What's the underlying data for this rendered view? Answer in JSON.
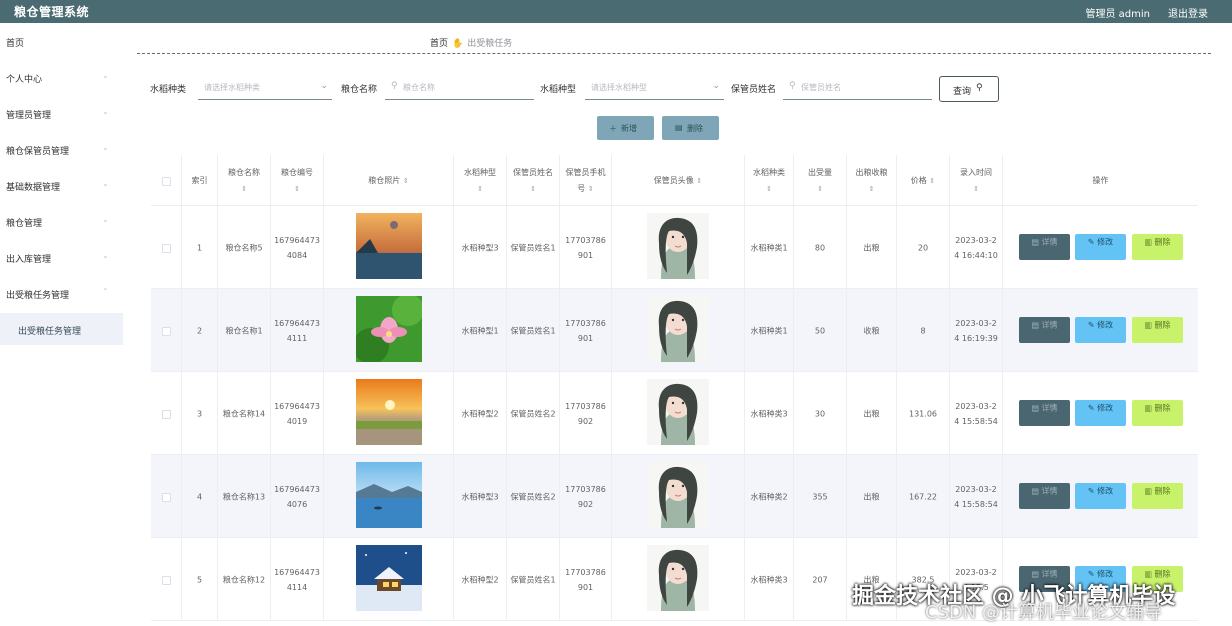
{
  "header": {
    "title": "粮仓管理系统",
    "admin_label": "管理员 admin",
    "logout_label": "退出登录"
  },
  "sidebar": {
    "items": [
      {
        "label": "首页"
      },
      {
        "label": "个人中心"
      },
      {
        "label": "管理员管理"
      },
      {
        "label": "粮仓保管员管理"
      },
      {
        "label": "基础数据管理"
      },
      {
        "label": "粮仓管理"
      },
      {
        "label": "出入库管理"
      },
      {
        "label": "出受粮任务管理"
      }
    ],
    "subitems": [
      {
        "label": "出受粮任务管理"
      }
    ]
  },
  "breadcrumb": {
    "home": "首页",
    "current": "出受粮任务"
  },
  "filters": {
    "rice_type_label": "水稻种类",
    "rice_type_placeholder": "请选择水稻种类",
    "granary_name_label": "粮仓名称",
    "granary_name_placeholder": "粮仓名称",
    "rice_kind_label": "水稻种型",
    "rice_kind_placeholder": "请选择水稻种型",
    "keeper_name_label": "保管员姓名",
    "keeper_name_placeholder": "保管员姓名",
    "query_label": "查询"
  },
  "actions": {
    "add_label": "新增",
    "delete_label": "删除"
  },
  "table": {
    "columns": {
      "index": "索引",
      "name": "粮仓名称",
      "code": "粮仓编号",
      "photo": "粮仓照片",
      "kind": "水稻种型",
      "keeper": "保管员姓名",
      "phone": "保管员手机号",
      "avatar": "保管员头像",
      "type": "水稻种类",
      "amount": "出受量",
      "direction": "出粮收粮",
      "price": "价格",
      "time": "录入时间",
      "ops": "操作"
    },
    "rows": [
      {
        "index": "1",
        "name": "粮仓名称5",
        "code": "1679644734084",
        "photo": "lake-sunset",
        "kind": "水稻种型3",
        "keeper": "保管员姓名1",
        "phone": "17703786901",
        "type": "水稻种类1",
        "amount": "80",
        "direction": "出粮",
        "price": "20",
        "time": "2023-03-24 16:44:10"
      },
      {
        "index": "2",
        "name": "粮仓名称1",
        "code": "1679644734111",
        "photo": "lotus",
        "kind": "水稻种型1",
        "keeper": "保管员姓名1",
        "phone": "17703786901",
        "type": "水稻种类1",
        "amount": "50",
        "direction": "收粮",
        "price": "8",
        "time": "2023-03-24 16:19:39"
      },
      {
        "index": "3",
        "name": "粮仓名称14",
        "code": "1679644734019",
        "photo": "meadow-sunset",
        "kind": "水稻种型2",
        "keeper": "保管员姓名2",
        "phone": "17703786902",
        "type": "水稻种类3",
        "amount": "30",
        "direction": "出粮",
        "price": "131.06",
        "time": "2023-03-24 15:58:54"
      },
      {
        "index": "4",
        "name": "粮仓名称13",
        "code": "1679644734076",
        "photo": "blue-lake",
        "kind": "水稻种型3",
        "keeper": "保管员姓名2",
        "phone": "17703786902",
        "type": "水稻种类2",
        "amount": "355",
        "direction": "出粮",
        "price": "167.22",
        "time": "2023-03-24 15:58:54"
      },
      {
        "index": "5",
        "name": "粮仓名称12",
        "code": "1679644734114",
        "photo": "snow-cabin",
        "kind": "水稻种型2",
        "keeper": "保管员姓名1",
        "phone": "17703786901",
        "type": "水稻种类3",
        "amount": "207",
        "direction": "出粮",
        "price": "382.5",
        "time": "2023-03-24 15:5"
      }
    ],
    "op_labels": {
      "detail": "详情",
      "edit": "修改",
      "delete": "删除"
    }
  },
  "watermark": {
    "line1": "掘金技术社区 @ 小飞计算机毕设",
    "line2": "CSDN @计算机毕业论文辅导"
  },
  "colors": {
    "header_bg": "#4a6b72",
    "detail_btn": "#4a6670",
    "edit_btn": "#63c3f4",
    "delete_btn": "#c9f26b",
    "toolbar_btn": "#7ea6b6"
  }
}
